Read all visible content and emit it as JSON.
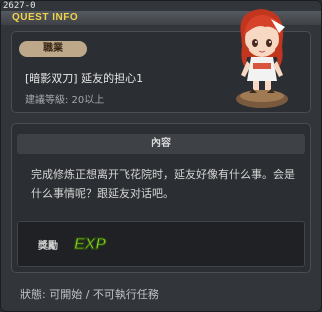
{
  "window": {
    "quest_id": "2627-0",
    "title": "QUEST INFO"
  },
  "quest": {
    "job_label": "職業",
    "name": "[暗影双刀] 延友的担心1",
    "required_level": "建議等級: 20以上"
  },
  "content": {
    "header": "內容",
    "description": "完成修炼正想离开飞花院时，延友好像有什么事。会是什么事情呢？跟延友对话吧。"
  },
  "reward": {
    "label": "獎勵",
    "exp_text": "EXP"
  },
  "status": {
    "text": "狀態: 可開始 / 不可執行任務"
  },
  "colors": {
    "title": "#f3d24a",
    "exp": "#8ee02e",
    "job_badge": "#bda98a"
  },
  "icons": {
    "npc": "npc-portrait-icon",
    "exp": "exp-icon"
  }
}
